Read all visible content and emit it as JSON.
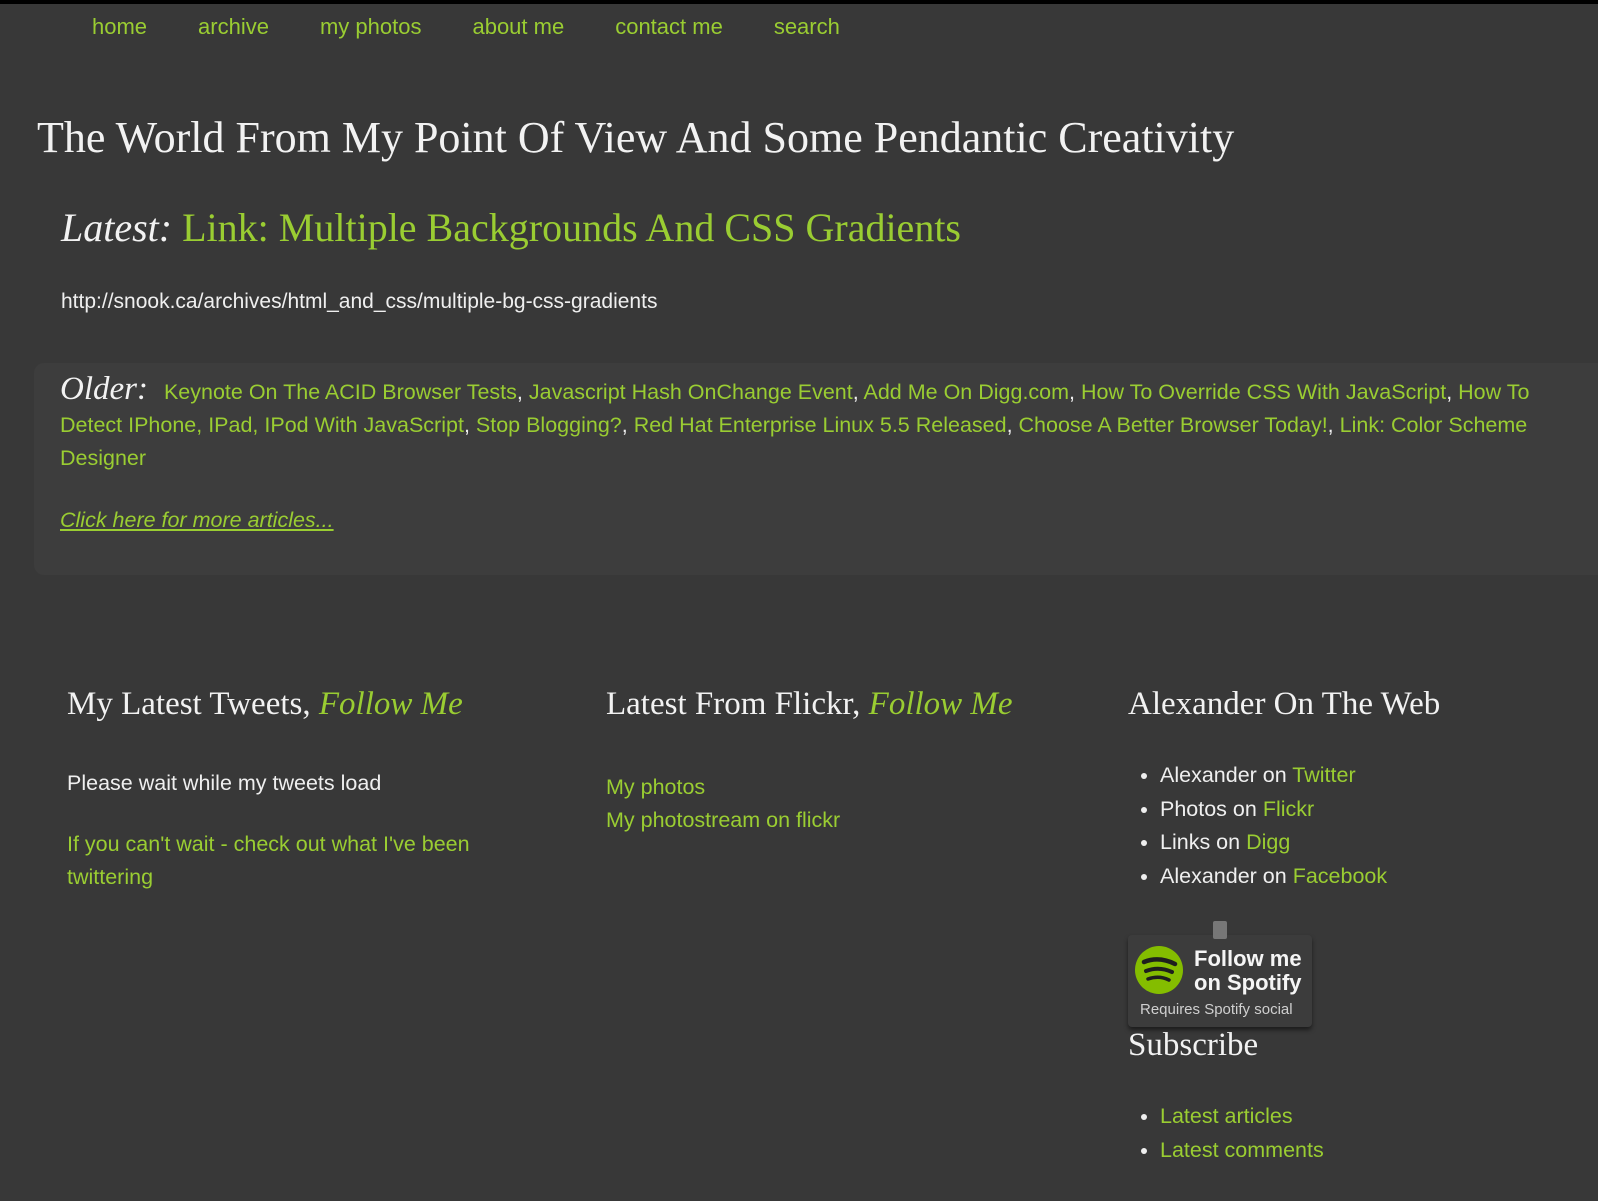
{
  "nav": {
    "items": [
      "home",
      "archive",
      "my photos",
      "about me",
      "contact me",
      "search"
    ]
  },
  "site": {
    "title": "The World From My Point Of View And Some Pendantic Creativity"
  },
  "latest": {
    "label": "Latest:",
    "title": "Link: Multiple Backgrounds And CSS Gradients",
    "body": "http://snook.ca/archives/html_and_css/multiple-bg-css-gradients"
  },
  "older": {
    "label": "Older:",
    "links": [
      "Keynote On The ACID Browser Tests",
      "Javascript Hash OnChange Event",
      "Add Me On Digg.com",
      "How To Override CSS With JavaScript",
      "How To Detect IPhone, IPad, IPod With JavaScript",
      "Stop Blogging?",
      "Red Hat Enterprise Linux 5.5 Released",
      "Choose A Better Browser Today!",
      "Link: Color Scheme Designer"
    ],
    "more": "Click here for more articles..."
  },
  "tweets": {
    "heading": "My Latest Tweets,",
    "follow": "Follow Me",
    "wait": "Please wait while my tweets load",
    "cant_wait": "If you can't wait - check out what I've been twittering"
  },
  "flickr": {
    "heading": "Latest From Flickr,",
    "follow": "Follow Me",
    "links": [
      "My photos",
      "My photostream on flickr"
    ]
  },
  "web": {
    "heading": "Alexander On The Web",
    "items": [
      {
        "prefix": "Alexander on",
        "link": "Twitter"
      },
      {
        "prefix": "Photos on",
        "link": "Flickr"
      },
      {
        "prefix": "Links on",
        "link": "Digg"
      },
      {
        "prefix": "Alexander on",
        "link": "Facebook"
      }
    ]
  },
  "spotify": {
    "line1": "Follow me",
    "line2": "on Spotify",
    "line3": "Requires Spotify social",
    "accent": "#84bd00"
  },
  "subscribe": {
    "heading": "Subscribe",
    "items": [
      "Latest articles",
      "Latest comments"
    ]
  },
  "colors": {
    "background": "#383838",
    "link": "#9acd32",
    "text": "#efefef"
  }
}
